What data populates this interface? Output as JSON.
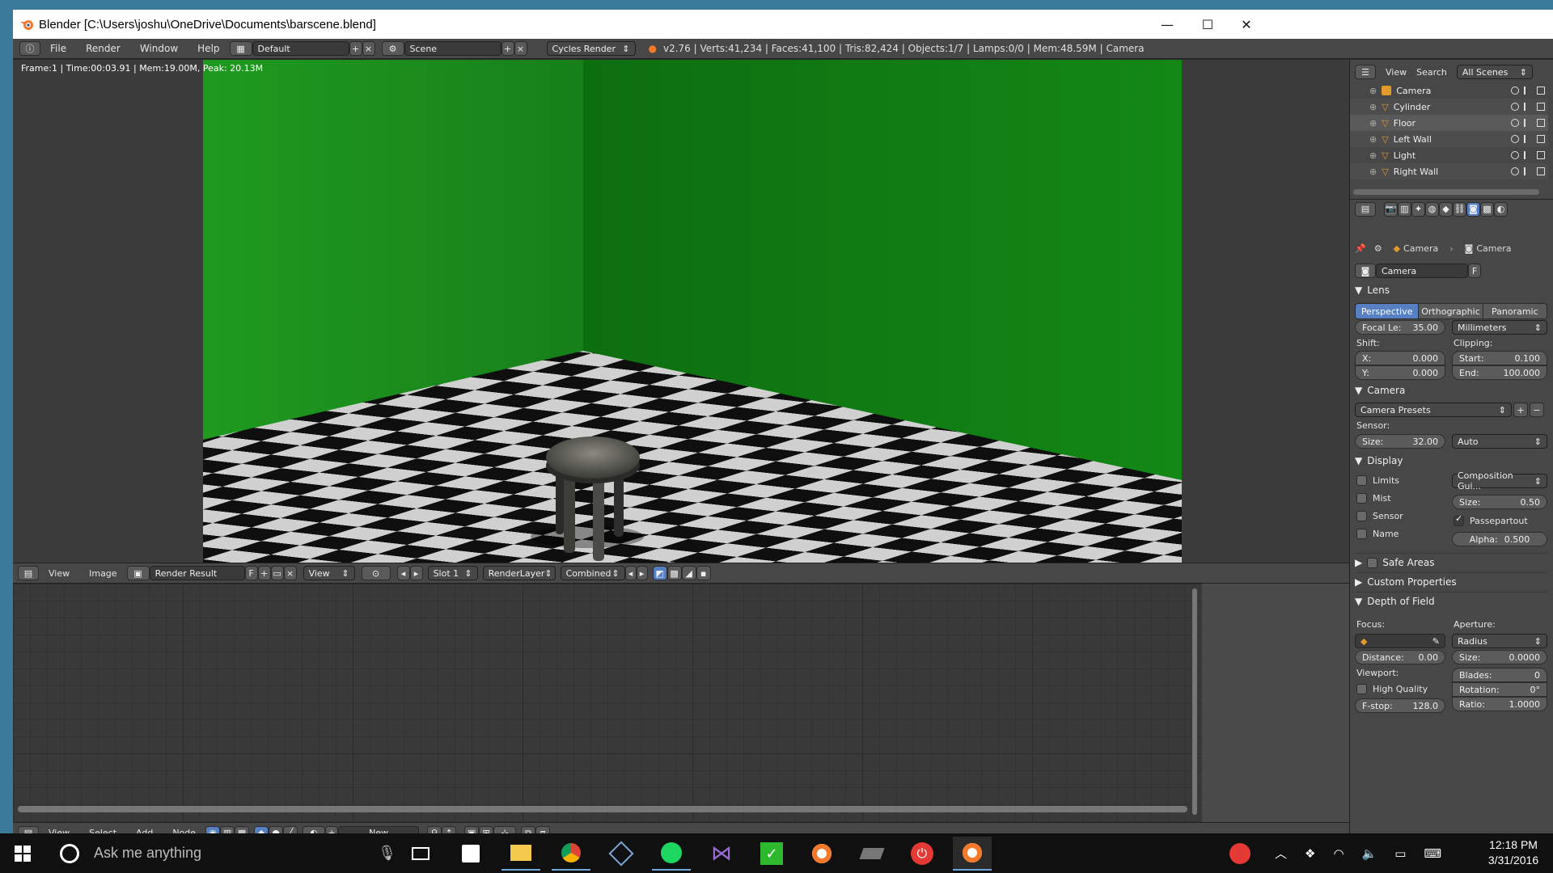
{
  "window": {
    "title": "Blender [C:\\Users\\joshu\\OneDrive\\Documents\\barscene.blend]",
    "minimize": "—",
    "maximize": "☐",
    "close": "✕"
  },
  "infobar": {
    "menus": [
      "File",
      "Render",
      "Window",
      "Help"
    ],
    "layout": "Default",
    "scene": "Scene",
    "engine": "Cycles Render",
    "stats": "v2.76 | Verts:41,234 | Faces:41,100 | Tris:82,424 | Objects:1/7 | Lamps:0/0 | Mem:48.59M | Camera"
  },
  "viewport": {
    "status": "Frame:1 | Time:00:03.91 | Mem:19.00M, Peak: 20.13M"
  },
  "image_editor": {
    "menus": [
      "View",
      "Image"
    ],
    "image_name": "Render Result",
    "fake_user": "F",
    "view": "View",
    "slot": "Slot 1",
    "layer": "RenderLayer",
    "pass": "Combined"
  },
  "node_editor": {
    "menus": [
      "View",
      "Select",
      "Add",
      "Node"
    ],
    "new_label": "New"
  },
  "outliner": {
    "view": "View",
    "search": "Search",
    "filter": "All Scenes",
    "items": [
      {
        "label": "Camera",
        "icon": "camera-icon"
      },
      {
        "label": "Cylinder",
        "icon": "mesh-icon"
      },
      {
        "label": "Floor",
        "icon": "mesh-icon"
      },
      {
        "label": "Left Wall",
        "icon": "mesh-icon"
      },
      {
        "label": "Light",
        "icon": "mesh-icon"
      },
      {
        "label": "Right Wall",
        "icon": "mesh-icon"
      }
    ]
  },
  "properties": {
    "breadcrumb_object": "Camera",
    "breadcrumb_data": "Camera",
    "datablock": "Camera",
    "datablock_fake": "F",
    "lens": {
      "title": "Lens",
      "tabs": [
        "Perspective",
        "Orthographic",
        "Panoramic"
      ],
      "focal_label": "Focal Le:",
      "focal_value": "35.00",
      "units": "Millimeters",
      "shift_label": "Shift:",
      "shift_x_label": "X:",
      "shift_x": "0.000",
      "shift_y_label": "Y:",
      "shift_y": "0.000",
      "clipping_label": "Clipping:",
      "start_label": "Start:",
      "start": "0.100",
      "end_label": "End:",
      "end": "100.000"
    },
    "camera": {
      "title": "Camera",
      "presets": "Camera Presets",
      "sensor_label": "Sensor:",
      "size_label": "Size:",
      "size": "32.00",
      "fit": "Auto"
    },
    "display": {
      "title": "Display",
      "limits": "Limits",
      "mist": "Mist",
      "sensor": "Sensor",
      "name": "Name",
      "guides": "Composition Gui...",
      "size_label": "Size:",
      "size": "0.50",
      "passepartout": "Passepartout",
      "alpha_label": "Alpha:",
      "alpha": "0.500"
    },
    "safe_areas": "Safe Areas",
    "custom_props": "Custom Properties",
    "dof": {
      "title": "Depth of Field",
      "focus_label": "Focus:",
      "aperture_label": "Aperture:",
      "aperture_type": "Radius",
      "distance_label": "Distance:",
      "distance": "0.00",
      "size_label": "Size:",
      "size": "0.0000",
      "viewport_label": "Viewport:",
      "blades_label": "Blades:",
      "blades": "0",
      "high_quality": "High Quality",
      "rotation_label": "Rotation:",
      "rotation": "0°",
      "fstop_label": "F-stop:",
      "fstop": "128.0",
      "ratio_label": "Ratio:",
      "ratio": "1.0000"
    }
  },
  "taskbar": {
    "search_placeholder": "Ask me anything",
    "time": "12:18 PM",
    "date": "3/31/2016"
  }
}
